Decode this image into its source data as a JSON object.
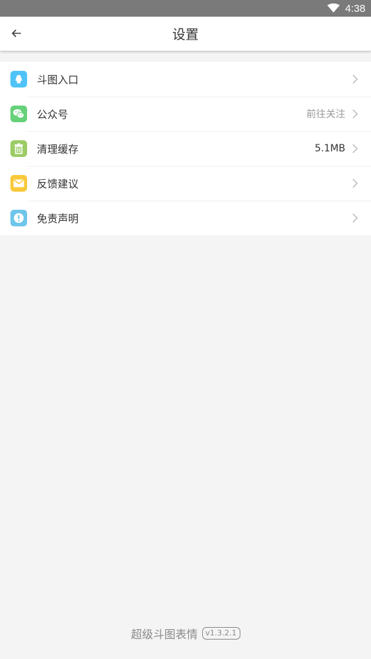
{
  "status_bar": {
    "time": "4:38",
    "icons": [
      "wifi-icon"
    ]
  },
  "header": {
    "title": "设置",
    "back_icon": "arrow-left-icon"
  },
  "items": [
    {
      "label": "斗图入口",
      "value": "",
      "icon": "qq-icon",
      "color": "#4fc3f7"
    },
    {
      "label": "公众号",
      "value": "前往关注",
      "icon": "wechat-icon",
      "color": "#66d17a"
    },
    {
      "label": "清理缓存",
      "value": "5.1MB",
      "icon": "trash-icon",
      "color": "#9ccc65"
    },
    {
      "label": "反馈建议",
      "value": "",
      "icon": "mail-icon",
      "color": "#f8c93a"
    },
    {
      "label": "免责声明",
      "value": "",
      "icon": "alert-icon",
      "color": "#6ec6ea"
    }
  ],
  "footer": {
    "app_name": "超级斗图表情",
    "version": "v1.3.2.1"
  }
}
